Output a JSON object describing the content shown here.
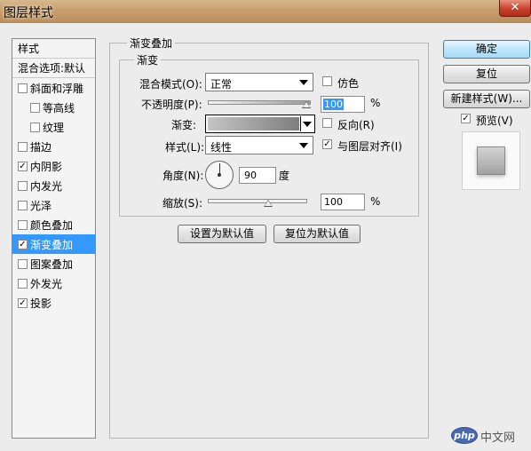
{
  "window": {
    "title": "图层样式",
    "close": "✕"
  },
  "left_panel": {
    "header1": "样式",
    "header2": "混合选项:默认",
    "items": [
      {
        "label": "斜面和浮雕",
        "checked": false,
        "indent": false
      },
      {
        "label": "等高线",
        "checked": false,
        "indent": true
      },
      {
        "label": "纹理",
        "checked": false,
        "indent": true
      },
      {
        "label": "描边",
        "checked": false,
        "indent": false
      },
      {
        "label": "内阴影",
        "checked": true,
        "indent": false
      },
      {
        "label": "内发光",
        "checked": false,
        "indent": false
      },
      {
        "label": "光泽",
        "checked": false,
        "indent": false
      },
      {
        "label": "颜色叠加",
        "checked": false,
        "indent": false
      },
      {
        "label": "渐变叠加",
        "checked": true,
        "indent": false,
        "selected": true
      },
      {
        "label": "图案叠加",
        "checked": false,
        "indent": false
      },
      {
        "label": "外发光",
        "checked": false,
        "indent": false
      },
      {
        "label": "投影",
        "checked": true,
        "indent": false
      }
    ]
  },
  "main": {
    "outer_title": "渐变叠加",
    "inner_title": "渐变",
    "blend_mode_label": "混合模式(O):",
    "blend_mode_value": "正常",
    "dither_label": "仿色",
    "dither_checked": false,
    "opacity_label": "不透明度(P):",
    "opacity_value": "100",
    "opacity_unit": "%",
    "gradient_label": "渐变:",
    "reverse_label": "反向(R)",
    "reverse_checked": false,
    "style_label": "样式(L):",
    "style_value": "线性",
    "align_label": "与图层对齐(I)",
    "align_checked": true,
    "angle_label": "角度(N):",
    "angle_value": "90",
    "angle_unit": "度",
    "scale_label": "缩放(S):",
    "scale_value": "100",
    "scale_unit": "%",
    "make_default": "设置为默认值",
    "reset_default": "复位为默认值"
  },
  "right_panel": {
    "ok": "确定",
    "reset": "复位",
    "new_style": "新建样式(W)...",
    "preview_label": "预览(V)",
    "preview_checked": true
  },
  "watermark": {
    "logo": "php",
    "text": "中文网"
  }
}
